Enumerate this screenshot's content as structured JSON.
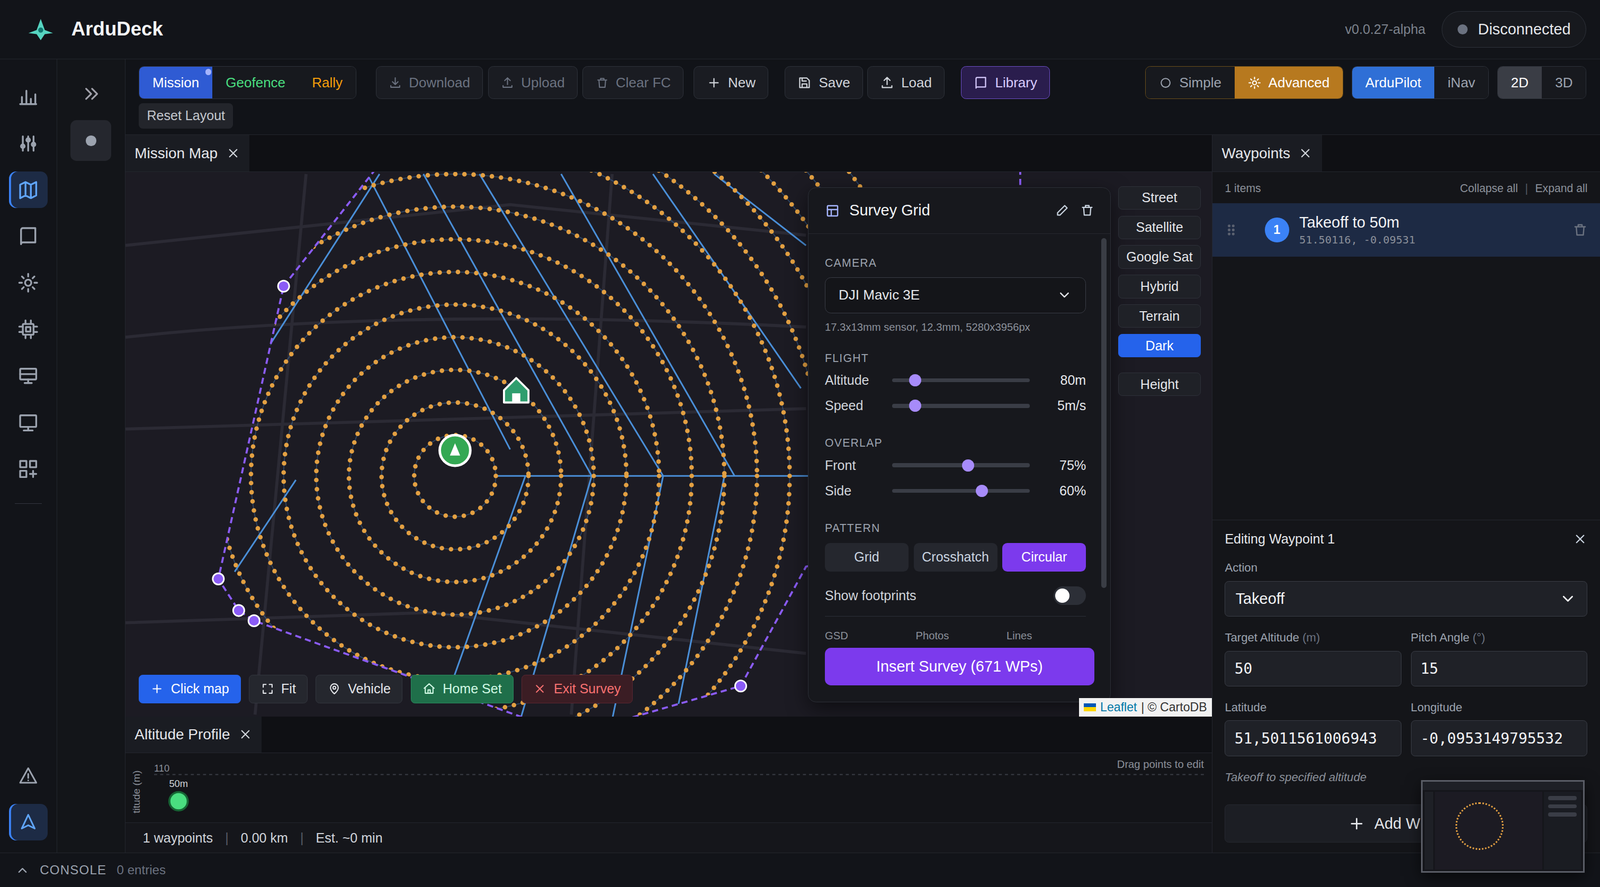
{
  "header": {
    "title": "ArduDeck",
    "version": "v0.0.27-alpha",
    "connection": {
      "label": "Disconnected",
      "connected": false
    }
  },
  "rail": {
    "items": [
      {
        "kind": "chart",
        "selected": false
      },
      {
        "kind": "sliders",
        "selected": false
      },
      {
        "kind": "map",
        "selected": true
      },
      {
        "kind": "book",
        "selected": false
      },
      {
        "kind": "gear",
        "selected": false
      },
      {
        "kind": "chip",
        "selected": false
      },
      {
        "kind": "monitor",
        "selected": false
      },
      {
        "kind": "display",
        "selected": false
      },
      {
        "kind": "modules",
        "selected": false
      }
    ],
    "bottom": [
      {
        "kind": "warning",
        "selected": false
      },
      {
        "kind": "app",
        "selected": true
      }
    ]
  },
  "toolbar": {
    "modes": [
      {
        "label": "Mission",
        "selected": true,
        "color": "#a5b4fc"
      },
      {
        "label": "Geofence",
        "selected": false,
        "color": "#4ade80"
      },
      {
        "label": "Rally",
        "selected": false,
        "color": "#f59e0b"
      }
    ],
    "fc_actions": [
      {
        "label": "Download",
        "kind": "download",
        "disabled": true
      },
      {
        "label": "Upload",
        "kind": "upload",
        "disabled": true
      },
      {
        "label": "Clear FC",
        "kind": "trash",
        "disabled": true
      }
    ],
    "file_actions": [
      {
        "label": "New",
        "kind": "plus"
      },
      {
        "label": "Save",
        "kind": "save"
      },
      {
        "label": "Load",
        "kind": "upload"
      }
    ],
    "library": {
      "label": "Library"
    },
    "reset": "Reset Layout",
    "ui_modes": [
      {
        "label": "Simple",
        "kind": "circle",
        "selected": false
      },
      {
        "label": "Advanced",
        "kind": "gear",
        "selected": true
      }
    ],
    "firmware": [
      {
        "label": "ArduPilot",
        "selected": true
      },
      {
        "label": "iNav",
        "selected": false
      }
    ],
    "view": [
      {
        "label": "2D",
        "selected": true
      },
      {
        "label": "3D",
        "selected": false
      }
    ]
  },
  "map": {
    "tab": "Mission Map",
    "layers": [
      {
        "label": "Street",
        "selected": false
      },
      {
        "label": "Satellite",
        "selected": false
      },
      {
        "label": "Google Sat",
        "selected": false
      },
      {
        "label": "Hybrid",
        "selected": false
      },
      {
        "label": "Terrain",
        "selected": false
      },
      {
        "label": "Dark",
        "selected": true
      }
    ],
    "height": {
      "label": "Height",
      "selected": false
    },
    "controls": [
      {
        "label": "Click map",
        "kind": "plus"
      },
      {
        "label": "Fit",
        "kind": "fit"
      },
      {
        "label": "Vehicle",
        "kind": "pin"
      },
      {
        "label": "Home Set",
        "kind": "home"
      },
      {
        "label": "Exit Survey",
        "kind": "close"
      }
    ],
    "attribution": {
      "link": "Leaflet",
      "text": "| © CartoDB"
    }
  },
  "survey": {
    "title": "Survey Grid",
    "camera": {
      "label": "CAMERA",
      "value": "DJI Mavic 3E",
      "spec": "17.3x13mm sensor, 12.3mm, 5280x3956px"
    },
    "sections": [
      {
        "title": "FLIGHT",
        "sliders": [
          {
            "label": "Altitude",
            "level": 0.165,
            "reading": "80m"
          },
          {
            "label": "Speed",
            "level": 0.165,
            "reading": "5m/s"
          }
        ]
      },
      {
        "title": "OVERLAP",
        "sliders": [
          {
            "label": "Front",
            "level": 0.55,
            "reading": "75%"
          },
          {
            "label": "Side",
            "level": 0.65,
            "reading": "60%"
          }
        ]
      }
    ],
    "pattern": {
      "title": "PATTERN",
      "options": [
        {
          "label": "Grid",
          "selected": false
        },
        {
          "label": "Crosshatch",
          "selected": false
        },
        {
          "label": "Circular",
          "selected": true
        }
      ]
    },
    "footprints": {
      "label": "Show footprints",
      "on": false
    },
    "stats": [
      "GSD",
      "Photos",
      "Lines"
    ],
    "insert": "Insert Survey (671 WPs)"
  },
  "altitude_profile": {
    "tab": "Altitude Profile",
    "axis": "titude (m)",
    "tick": "110",
    "hint": "Drag points to edit",
    "max": 110,
    "points": [
      {
        "label": "50m",
        "value": 50
      }
    ]
  },
  "stats": {
    "separator": "|",
    "items": [
      "1 waypoints",
      "0.00 km",
      "Est. ~0 min"
    ]
  },
  "waypoints": {
    "tab": "Waypoints",
    "count": "1 items",
    "collapse": "Collapse all",
    "separator": "|",
    "expand": "Expand all",
    "items": [
      {
        "number": "1",
        "title": "Takeoff to 50m",
        "coords": "51.50116, -0.09531",
        "selected": true
      }
    ],
    "editor": {
      "title": "Editing Waypoint 1",
      "action_label": "Action",
      "action": "Takeoff",
      "fields": [
        {
          "label": "Target Altitude",
          "unit": "(m)",
          "value": "50"
        },
        {
          "label": "Pitch Angle",
          "unit": "(°)",
          "value": "15"
        },
        {
          "label": "Latitude",
          "unit": "",
          "value": "51,5011561006943"
        },
        {
          "label": "Longitude",
          "unit": "",
          "value": "-0,0953149795532"
        }
      ],
      "hint": "Takeoff to specified altitude",
      "add": "Add W"
    }
  },
  "console": {
    "label": "CONSOLE",
    "count": "0 entries"
  }
}
